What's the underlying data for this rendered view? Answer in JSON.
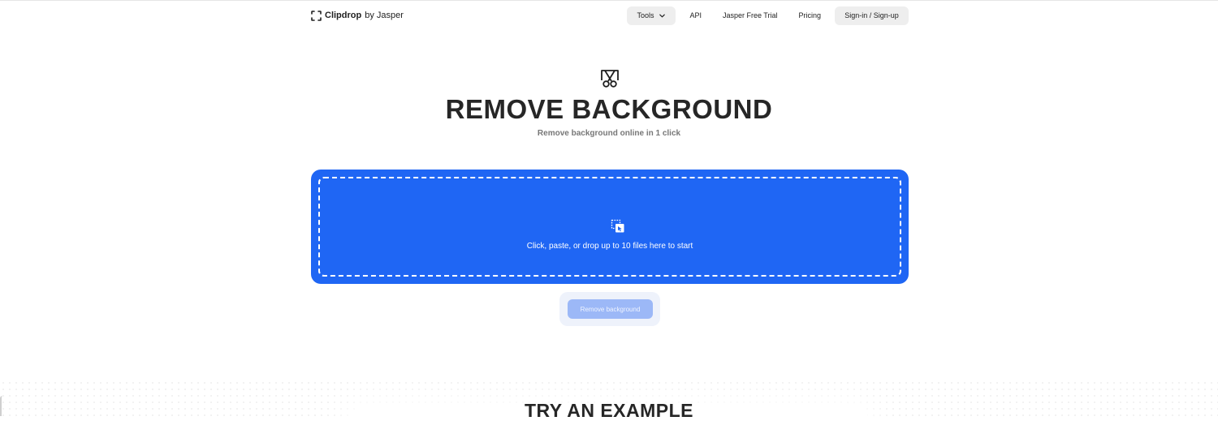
{
  "brand": {
    "name": "Clipdrop",
    "by": "by Jasper"
  },
  "nav": {
    "tools": "Tools",
    "api": "API",
    "trial": "Jasper Free Trial",
    "pricing": "Pricing",
    "signin": "Sign-in / Sign-up"
  },
  "hero": {
    "icon": "scissors-frame-icon",
    "title": "REMOVE BACKGROUND",
    "subtitle": "Remove background online in 1 click"
  },
  "dropzone": {
    "icon": "upload-files-icon",
    "text": "Click, paste, or drop up to 10 files here to start",
    "color": "#1f66f4"
  },
  "action": {
    "remove_label": "Remove background"
  },
  "examples": {
    "title": "TRY AN EXAMPLE"
  }
}
